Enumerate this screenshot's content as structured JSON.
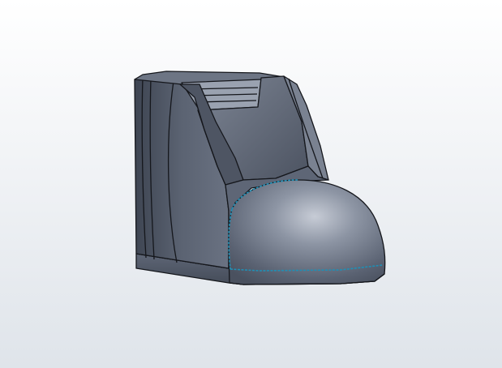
{
  "viewport": {
    "background_top": "#ffffff",
    "background_bottom": "#dfe4ea",
    "model": {
      "name": "boot-model",
      "body_color": "#58606f",
      "body_shade_color": "#3e4552",
      "edge_color": "#15171c",
      "toe_highlight_color": "#c7ccd6",
      "selected_edge_color": "#1f8fb5"
    }
  }
}
